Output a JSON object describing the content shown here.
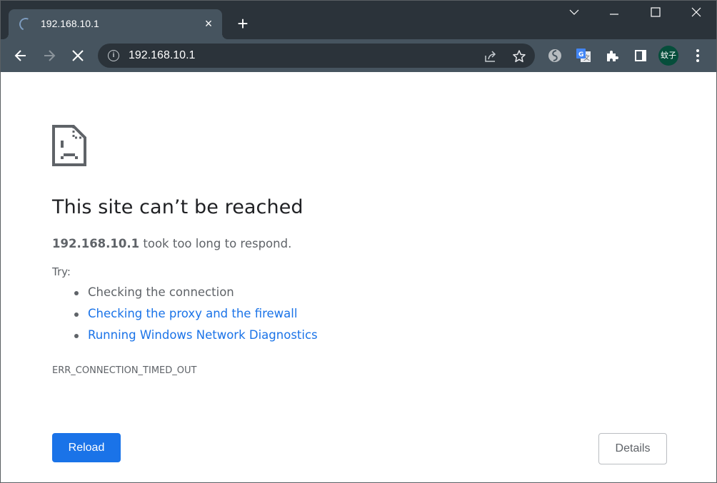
{
  "browser": {
    "tab": {
      "title": "192.168.10.1",
      "loading": true,
      "close_label": "×"
    },
    "new_tab_label": "+",
    "window_controls": [
      "tab-search",
      "minimize",
      "maximize",
      "close"
    ],
    "address_bar": {
      "url": "192.168.10.1",
      "security_icon": "info-icon"
    },
    "nav_buttons": [
      "back",
      "forward",
      "stop"
    ],
    "omnibox_actions": [
      "share-icon",
      "bookmark-star-icon"
    ],
    "extensions": [
      "simplenote-icon",
      "google-translate-icon",
      "extensions-puzzle-icon",
      "side-panel-icon"
    ],
    "profile": {
      "avatar_text": "蚊子",
      "avatar_color": "#064e3b"
    },
    "menu_icon": "kebab-menu-icon"
  },
  "error_page": {
    "icon": "sad-page-icon",
    "title": "This site can’t be reached",
    "summary_host": "192.168.10.1",
    "summary_text": " took too long to respond.",
    "try_label": "Try:",
    "suggestions": [
      {
        "text": "Checking the connection",
        "link": false
      },
      {
        "text": "Checking the proxy and the firewall",
        "link": true
      },
      {
        "text": "Running Windows Network Diagnostics",
        "link": true
      }
    ],
    "error_code": "ERR_CONNECTION_TIMED_OUT",
    "reload_label": "Reload",
    "details_label": "Details",
    "accent_color": "#1a73e8"
  }
}
